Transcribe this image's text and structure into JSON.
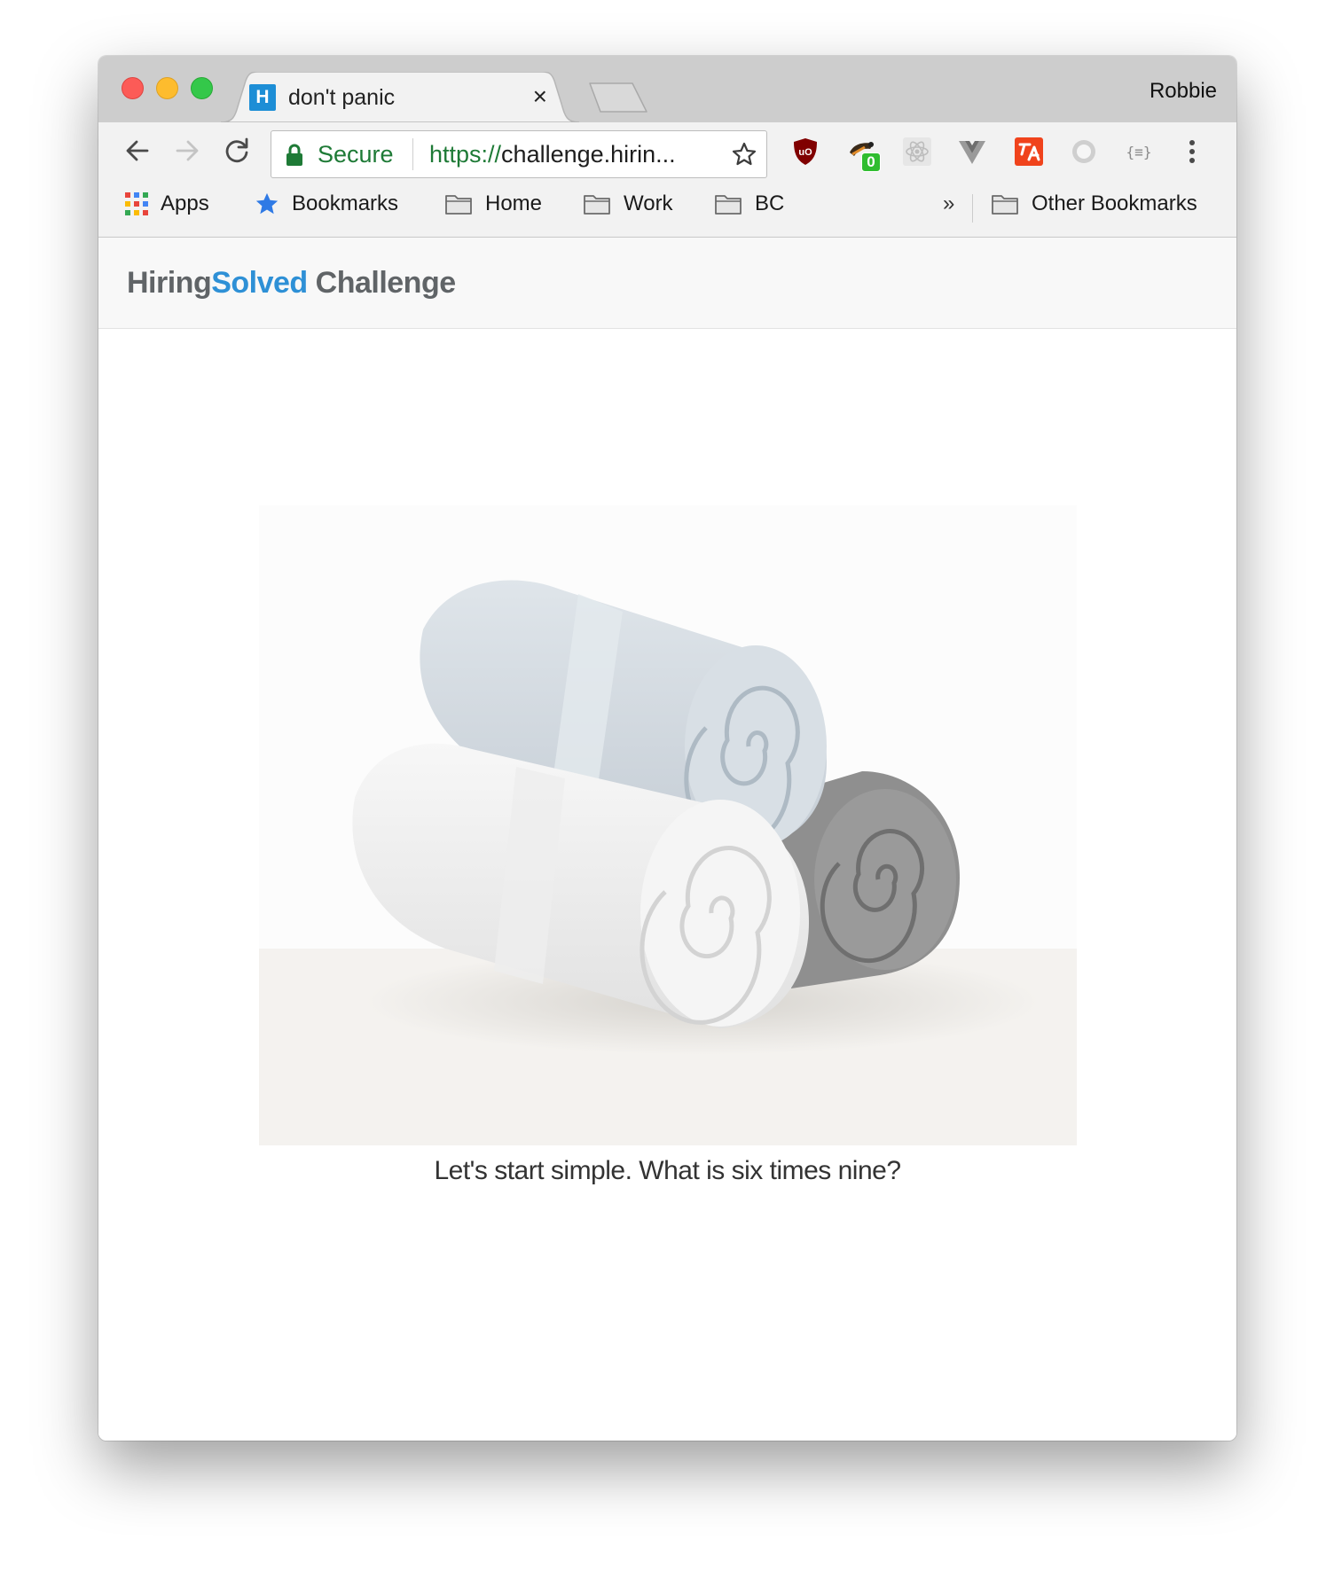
{
  "browser": {
    "tab": {
      "favicon_letter": "H",
      "title": "don't panic",
      "close_glyph": "×"
    },
    "profile_name": "Robbie",
    "omnibox": {
      "security_label": "Secure",
      "url_scheme": "https://",
      "url_rest": "challenge.hirin..."
    },
    "extensions": [
      {
        "name": "ublock-origin-icon"
      },
      {
        "name": "tampermonkey-icon",
        "badge": "0"
      },
      {
        "name": "react-devtools-icon"
      },
      {
        "name": "vue-devtools-icon"
      },
      {
        "name": "translate-extension-icon"
      },
      {
        "name": "circle-extension-icon"
      },
      {
        "name": "json-viewer-icon",
        "label": "{≡}"
      }
    ],
    "bookmarks": {
      "items": [
        {
          "label": "Apps",
          "icon": "apps-grid-icon"
        },
        {
          "label": "Bookmarks",
          "icon": "star-icon"
        },
        {
          "label": "Home",
          "icon": "folder-icon"
        },
        {
          "label": "Work",
          "icon": "folder-icon"
        },
        {
          "label": "BC",
          "icon": "folder-icon"
        }
      ],
      "overflow_glyph": "»",
      "other_label": "Other Bookmarks"
    }
  },
  "page": {
    "brand": {
      "part1": "Hiring",
      "part2": "Solved",
      "part3": " Challenge"
    },
    "question": "Let's start simple. What is six times nine?"
  },
  "colors": {
    "brand_gray": "#606467",
    "brand_blue": "#2e90d6",
    "secure_green": "#1e7a36",
    "favicon_blue": "#1d8ed6"
  }
}
